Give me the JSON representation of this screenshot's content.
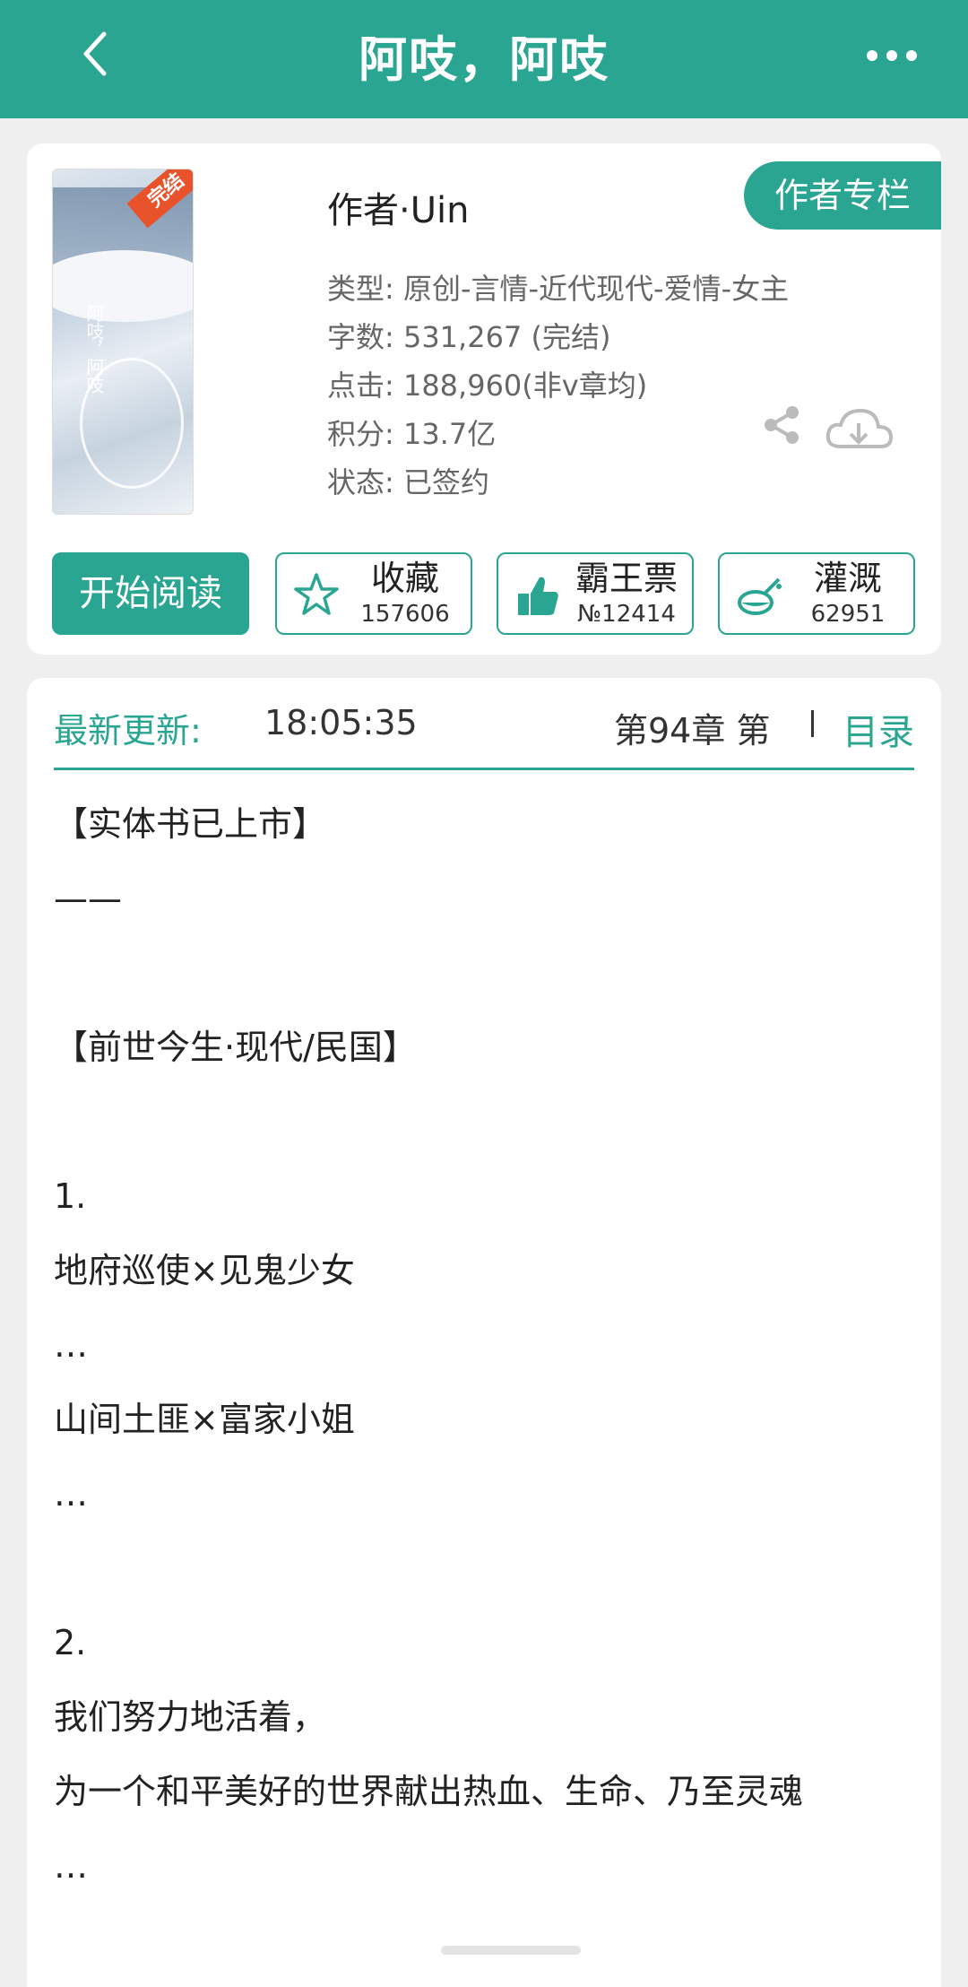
{
  "header": {
    "title": "阿吱，阿吱"
  },
  "book": {
    "cover_title": "阿吱，阿吱",
    "cover_stamp": "完结",
    "author": "作者·Uin",
    "column_button": "作者专栏",
    "meta": [
      "类型: 原创-言情-近代现代-爱情-女主",
      "字数: 531,267 (完结)",
      "点击: 188,960(非v章均)",
      "积分: 13.7亿",
      "状态: 已签约"
    ]
  },
  "actions": {
    "start_reading": "开始阅读",
    "favorite": {
      "label": "收藏",
      "count": "157606"
    },
    "overlord": {
      "label": "霸王票",
      "count": "№12414"
    },
    "nourish": {
      "label": "灌溉",
      "count": "62951"
    }
  },
  "update": {
    "label": "最新更新:",
    "time": "18:05:35",
    "chapter": "第94章  第",
    "toc": "目录"
  },
  "description": [
    "【实体书已上市】",
    "——",
    "",
    "【前世今生·现代/民国】",
    "",
    "1.",
    "地府巡使×见鬼少女",
    "…",
    "山间土匪×富家小姐",
    "…",
    "",
    "2.",
    "我们努力地活着，",
    "为一个和平美好的世界献出热血、生命、乃至灵魂",
    "…"
  ],
  "colors": {
    "accent": "#2aa592",
    "stamp": "#e8532b"
  }
}
